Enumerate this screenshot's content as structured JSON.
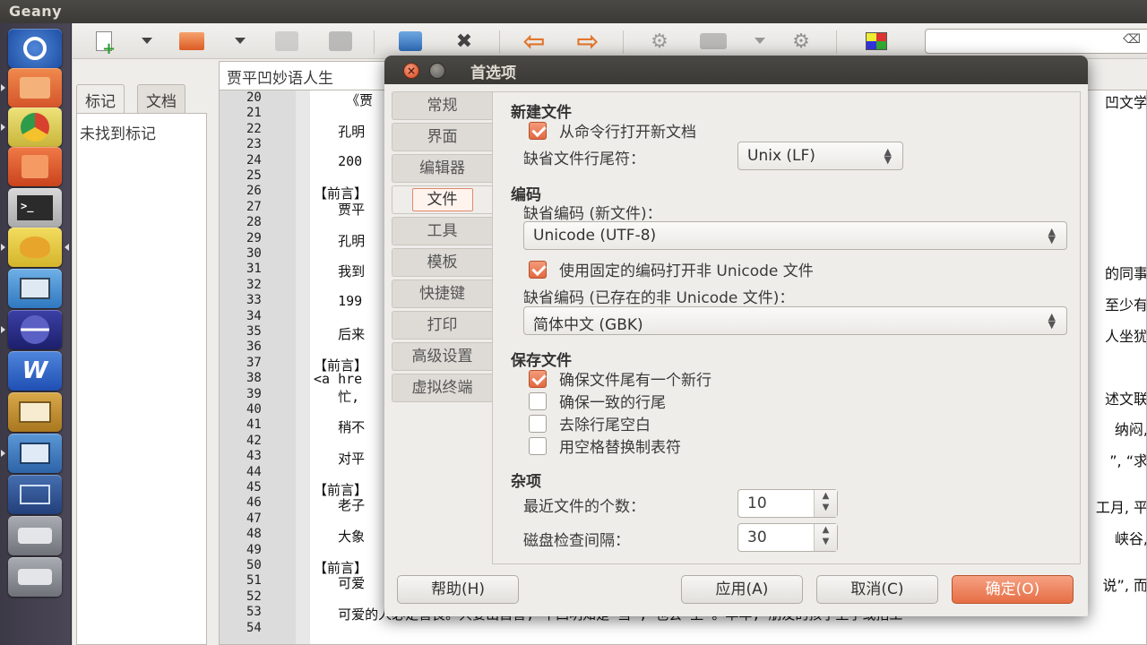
{
  "topbar": {
    "app_name": "Geany"
  },
  "launcher": {
    "items": [
      {
        "name": "dash",
        "color": "#2f6fcf"
      },
      {
        "name": "files",
        "color": "#e8742f"
      },
      {
        "name": "chrome",
        "color": "#e4d35a"
      },
      {
        "name": "software-center",
        "color": "#e25c2b"
      },
      {
        "name": "terminal",
        "color": "#333333"
      },
      {
        "name": "geany",
        "color": "#e5c640"
      },
      {
        "name": "remote-desktop",
        "color": "#3f86c9"
      },
      {
        "name": "eclipse",
        "color": "#2a2e8a"
      },
      {
        "name": "wps-writer",
        "color": "#2b5fc8"
      },
      {
        "name": "dictionary",
        "color": "#c38f2b"
      },
      {
        "name": "system-monitor",
        "color": "#2f6cb1"
      },
      {
        "name": "workspaces",
        "color": "#2c4f8f"
      },
      {
        "name": "drive-1",
        "color": "#8b8e95"
      },
      {
        "name": "drive-2",
        "color": "#8b8e95"
      }
    ]
  },
  "sidebar": {
    "tab_symbols": "标记",
    "tab_documents": "文档",
    "empty_text": "未找到标记"
  },
  "editor": {
    "file_tab": "贾平凹妙语人生",
    "line_numbers": [
      "20",
      "21",
      "22",
      "23",
      "24",
      "25",
      "26",
      "27",
      "28",
      "29",
      "30",
      "31",
      "32",
      "33",
      "34",
      "35",
      "36",
      "37",
      "38",
      "39",
      "40",
      "41",
      "42",
      "43",
      "44",
      "45",
      "46",
      "47",
      "48",
      "49",
      "50",
      "51",
      "52",
      "53",
      "54"
    ],
    "lines": [
      {
        "n": "20",
        "left": "    《贾",
        "right": "凹文学"
      },
      {
        "n": "22",
        "left": "   孔明",
        "right": ""
      },
      {
        "n": "24",
        "left": "   200",
        "right": ""
      },
      {
        "n": "26",
        "left": "【前言】",
        "right": ""
      },
      {
        "n": "27",
        "left": "   贾平",
        "right": ""
      },
      {
        "n": "29",
        "left": "   孔明",
        "right": ""
      },
      {
        "n": "31",
        "left": "   我到",
        "right": "的同事"
      },
      {
        "n": "33",
        "left": "   199",
        "right": "至少有"
      },
      {
        "n": "35",
        "left": "   后来",
        "right": "人坐犹"
      },
      {
        "n": "37",
        "left": "【前言】",
        "right": ""
      },
      {
        "n": "38",
        "left": "<a hre",
        "right": ""
      },
      {
        "n": "39",
        "left": "   忙,",
        "right": "述文联"
      },
      {
        "n": "41",
        "left": "   稍不",
        "right": "纳闷,"
      },
      {
        "n": "43",
        "left": "   对平",
        "right": "”, “求"
      },
      {
        "n": "45",
        "left": "【前言】",
        "right": ""
      },
      {
        "n": "46",
        "left": "   老子",
        "right": "工月, 平"
      },
      {
        "n": "48",
        "left": "   大象",
        "right": "峡谷,"
      },
      {
        "n": "50",
        "left": "【前言】",
        "right": ""
      },
      {
        "n": "51",
        "left": "   可爱",
        "right": "说”, 而"
      },
      {
        "n": "53",
        "left": "   可爱的人必定善良。只要出自善, 平凹明知是“当”, 也会“上”。早年, 朋友的孩子上学或招工",
        "right": ""
      }
    ]
  },
  "dialog": {
    "title": "首选项",
    "tabs": [
      "常规",
      "界面",
      "编辑器",
      "文件",
      "工具",
      "模板",
      "快捷键",
      "打印",
      "高级设置",
      "虚拟终端"
    ],
    "active_tab": "文件",
    "sections": {
      "new_files": {
        "heading": "新建文件",
        "open_from_cmdline_label": "从命令行打开新文档",
        "open_from_cmdline_checked": true,
        "default_eol_label": "缺省文件行尾符：",
        "default_eol_value": "Unix (LF)"
      },
      "encoding": {
        "heading": "编码",
        "default_new_label": "缺省编码 (新文件)：",
        "default_new_value": "Unicode (UTF-8)",
        "use_fixed_label": "使用固定的编码打开非 Unicode 文件",
        "use_fixed_checked": true,
        "default_existing_label": "缺省编码 (已存在的非 Unicode 文件)：",
        "default_existing_value": "简体中文 (GBK)"
      },
      "saving": {
        "heading": "保存文件",
        "ensure_newline_label": "确保文件尾有一个新行",
        "ensure_newline_checked": true,
        "consistent_eol_label": "确保一致的行尾",
        "consistent_eol_checked": false,
        "strip_trailing_label": "去除行尾空白",
        "strip_trailing_checked": false,
        "replace_tabs_label": "用空格替换制表符",
        "replace_tabs_checked": false
      },
      "misc": {
        "heading": "杂项",
        "recent_files_label": "最近文件的个数：",
        "recent_files_value": "10",
        "disk_check_label": "磁盘检查间隔：",
        "disk_check_value": "30"
      }
    },
    "buttons": {
      "help": "帮助(H)",
      "apply": "应用(A)",
      "cancel": "取消(C)",
      "ok": "确定(O)"
    },
    "accent_color": "#e66e44"
  }
}
